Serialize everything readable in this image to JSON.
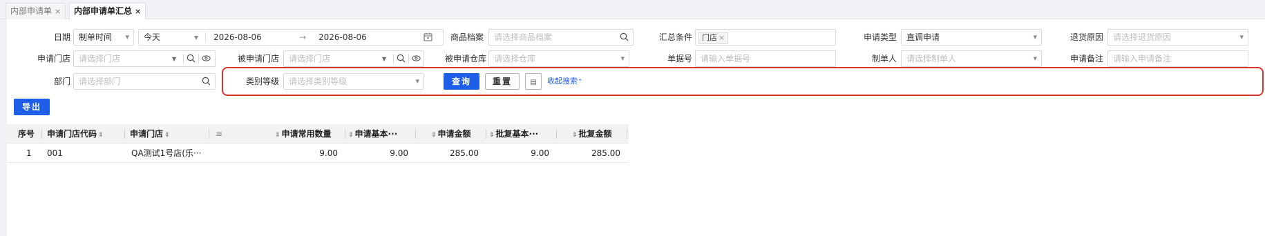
{
  "tabs": [
    {
      "label": "内部申请单",
      "close": "×"
    },
    {
      "label": "内部申请单汇总",
      "close": "×"
    }
  ],
  "filters": {
    "date_label": "日期",
    "date_type_value": "制单时间",
    "date_range_preset": "今天",
    "date_start": "2026-08-06",
    "date_sep": "→",
    "date_end": "2026-08-06",
    "product_label": "商品档案",
    "product_placeholder": "请选择商品档案",
    "summary_label": "汇总条件",
    "summary_tag": "门店",
    "summary_tag_close": "×",
    "apply_type_label": "申请类型",
    "apply_type_value": "直调申请",
    "return_reason_label": "退货原因",
    "return_reason_placeholder": "请选择退货原因",
    "apply_store_label": "申请门店",
    "apply_store_placeholder": "请选择门店",
    "target_store_label": "被申请门店",
    "target_store_placeholder": "请选择门店",
    "target_warehouse_label": "被申请仓库",
    "target_warehouse_placeholder": "请选择仓库",
    "doc_no_label": "单据号",
    "doc_no_placeholder": "请输入单据号",
    "creator_label": "制单人",
    "creator_placeholder": "请选择制单人",
    "remark_label": "申请备注",
    "remark_placeholder": "请输入申请备注",
    "dept_label": "部门",
    "dept_placeholder": "请选择部门",
    "category_level_label": "类别等级",
    "category_level_placeholder": "请选择类别等级"
  },
  "actions": {
    "query": "查询",
    "reset": "重置",
    "collapse": "收起搜索",
    "export": "导出"
  },
  "table": {
    "headers": [
      "序号",
      "申请门店代码",
      "申请门店",
      "申请常用数量",
      "申请基本···",
      "申请金额",
      "批复基本···",
      "批复金额"
    ],
    "rows": [
      {
        "index": "1",
        "store_code": "001",
        "store_name": "QA测试1号店(乐···",
        "apply_qty": "9.00",
        "apply_basic": "9.00",
        "apply_amount": "285.00",
        "approve_basic": "9.00",
        "approve_amount": "285.00"
      }
    ]
  }
}
